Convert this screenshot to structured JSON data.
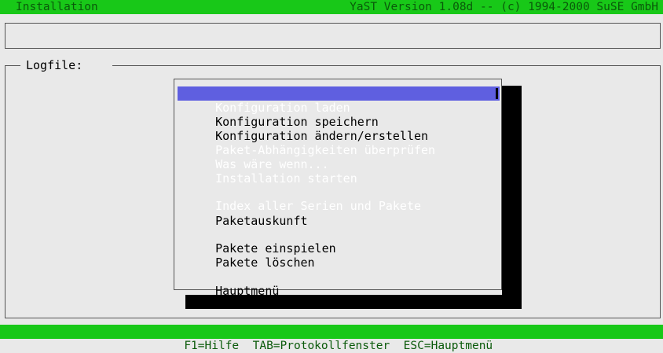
{
  "top_bar": {
    "left": "Installation",
    "right": "YaST Version 1.08d -- (c) 1994-2000 SuSE GmbH"
  },
  "log_frame": {
    "title": "Logfile:"
  },
  "menu": {
    "items": [
      {
        "label": "Konfiguration laden",
        "state": "selected"
      },
      {
        "label": "Konfiguration speichern",
        "state": "enabled"
      },
      {
        "label": "Konfiguration ändern/erstellen",
        "state": "enabled"
      },
      {
        "label": "Paket-Abhängigkeiten überprüfen",
        "state": "disabled"
      },
      {
        "label": "Was wäre wenn...",
        "state": "disabled"
      },
      {
        "label": "Installation starten",
        "state": "disabled"
      },
      {
        "label": "Index aller Serien und Pakete",
        "state": "disabled"
      },
      {
        "label": "Paketauskunft",
        "state": "enabled"
      },
      {
        "label": "Pakete einspielen",
        "state": "enabled"
      },
      {
        "label": "Pakete löschen",
        "state": "enabled"
      },
      {
        "label": "Hauptmenü",
        "state": "enabled"
      }
    ]
  },
  "bottom_bar": {
    "text": "F1=Hilfe  TAB=Protokollfenster  ESC=Hauptmenü"
  },
  "colors": {
    "status_bar": "#18c818",
    "status_text": "#0a5a0a",
    "selection": "#5f5fe0",
    "background": "#e9e9e9"
  }
}
